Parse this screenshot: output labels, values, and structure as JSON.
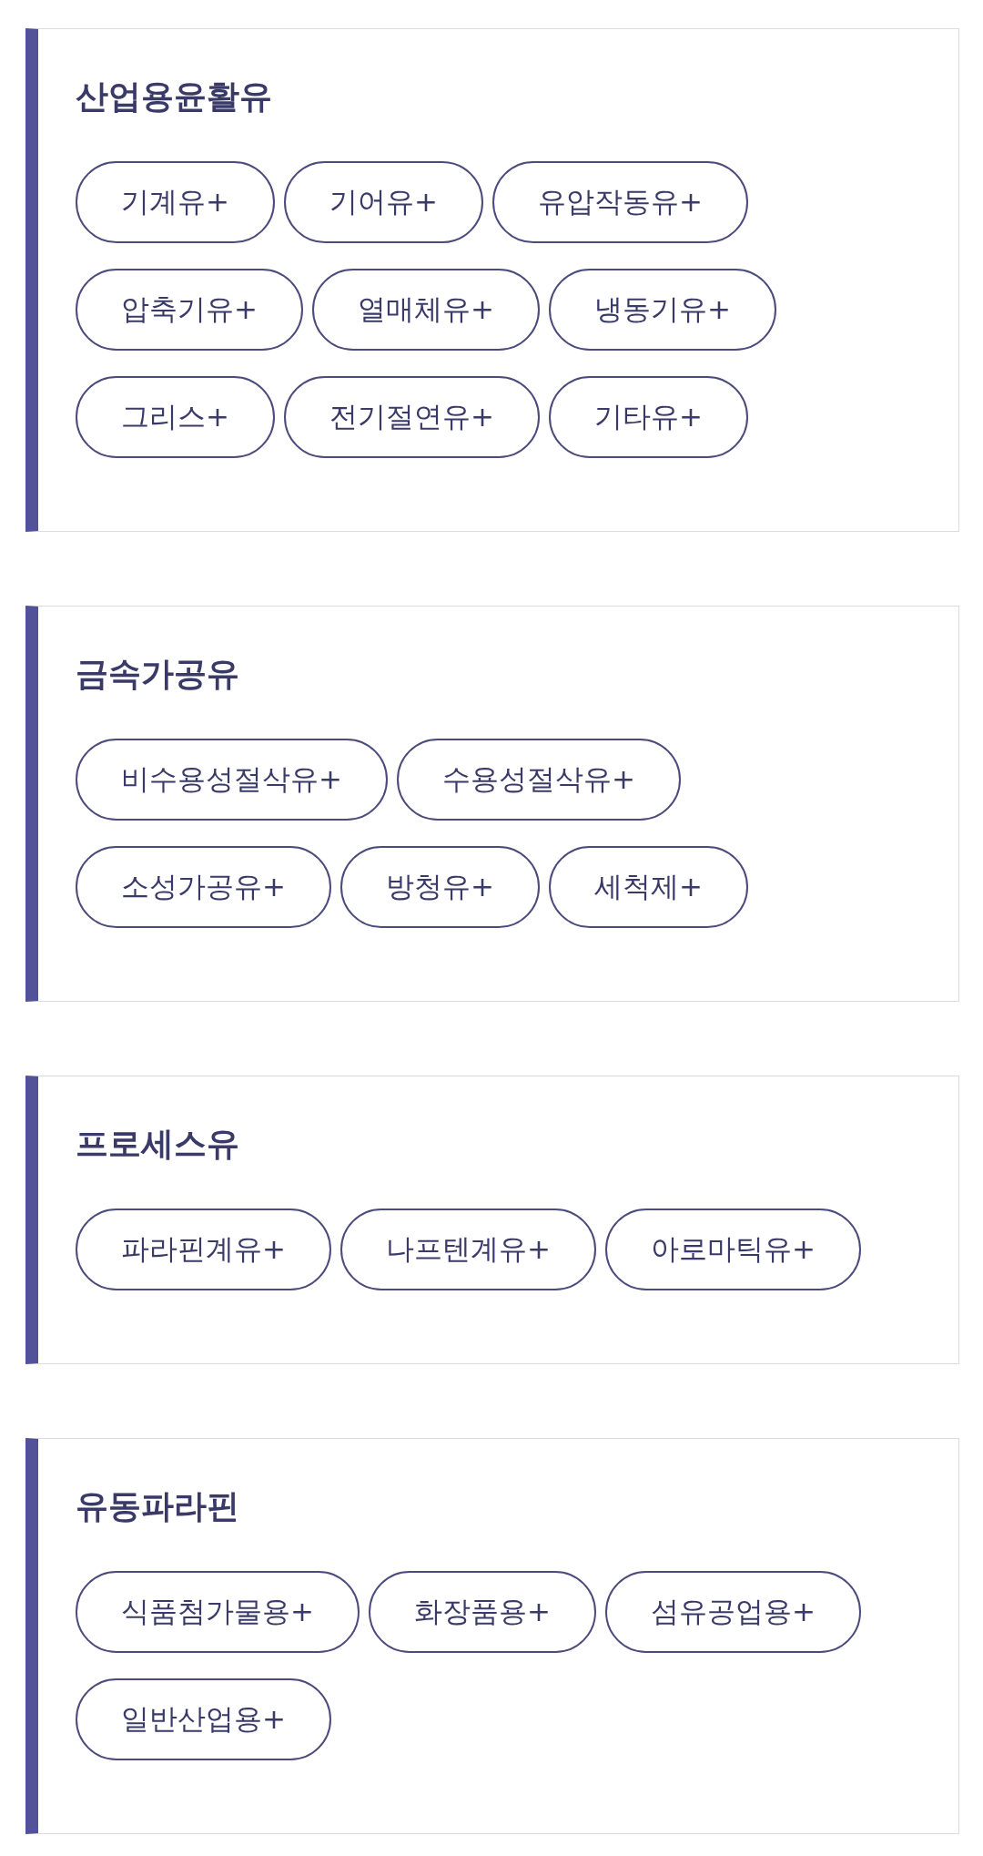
{
  "sections": [
    {
      "title": "산업용윤활유",
      "items": [
        "기계유+",
        "기어유+",
        "유압작동유+",
        "압축기유+",
        "열매체유+",
        "냉동기유+",
        "그리스+",
        "전기절연유+",
        "기타유+"
      ]
    },
    {
      "title": "금속가공유",
      "items": [
        "비수용성절삭유+",
        "수용성절삭유+",
        "소성가공유+",
        "방청유+",
        "세척제+"
      ]
    },
    {
      "title": "프로세스유",
      "items": [
        "파라핀계유+",
        "나프텐계유+",
        "아로마틱유+"
      ]
    },
    {
      "title": "유동파라핀",
      "items": [
        "식품첨가물용+",
        "화장품용+",
        "섬유공업용+",
        "일반산업용+"
      ]
    }
  ]
}
